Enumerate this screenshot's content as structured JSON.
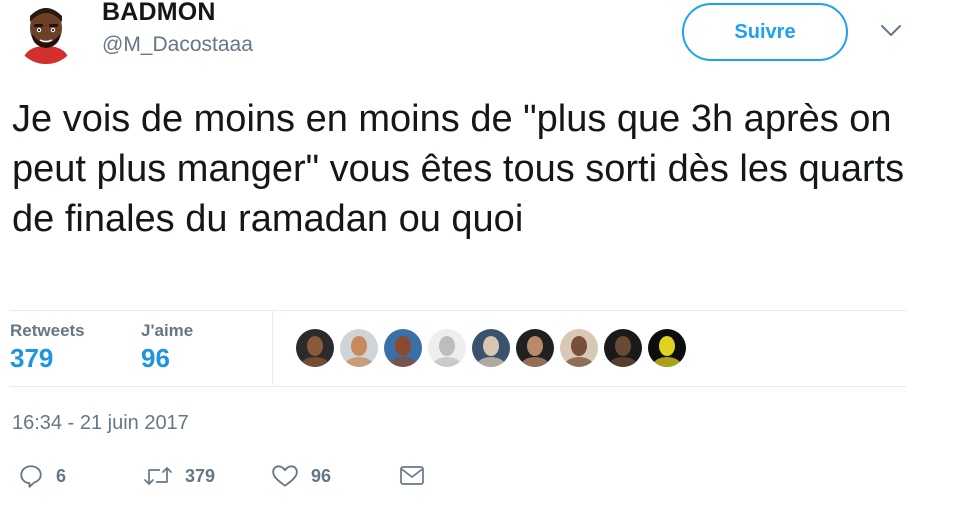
{
  "author": {
    "name": "BADMON",
    "handle": "@M_Dacostaaa"
  },
  "follow_label": "Suivre",
  "tweet_text": "Je vois de moins en moins de \"plus que 3h après on peut plus manger\" vous êtes tous sorti dès les quarts de finales du ramadan ou quoi",
  "stats": {
    "retweets_label": "Retweets",
    "retweets_value": "379",
    "likes_label": "J'aime",
    "likes_value": "96"
  },
  "liker_avatars": [
    {
      "bg": "#2b2b2b",
      "face": "#8a5a3b"
    },
    {
      "bg": "#cfd4d8",
      "face": "#c78a5e"
    },
    {
      "bg": "#3b6fa8",
      "face": "#8b4a2f"
    },
    {
      "bg": "#eeeeee",
      "face": "#bdbdbd"
    },
    {
      "bg": "#39526e",
      "face": "#d9c5b0"
    },
    {
      "bg": "#202020",
      "face": "#b88a6a"
    },
    {
      "bg": "#d8c9b5",
      "face": "#7a4f3a"
    },
    {
      "bg": "#1a1a1a",
      "face": "#6b4a35"
    },
    {
      "bg": "#0d0d0d",
      "face": "#e0d21e"
    }
  ],
  "timestamp": "16:34 - 21 juin 2017",
  "actions": {
    "reply_count": "6",
    "retweet_count": "379",
    "like_count": "96"
  },
  "colors": {
    "accent": "#1da1f2",
    "stat_value": "#1c94e0",
    "muted": "#657786"
  }
}
